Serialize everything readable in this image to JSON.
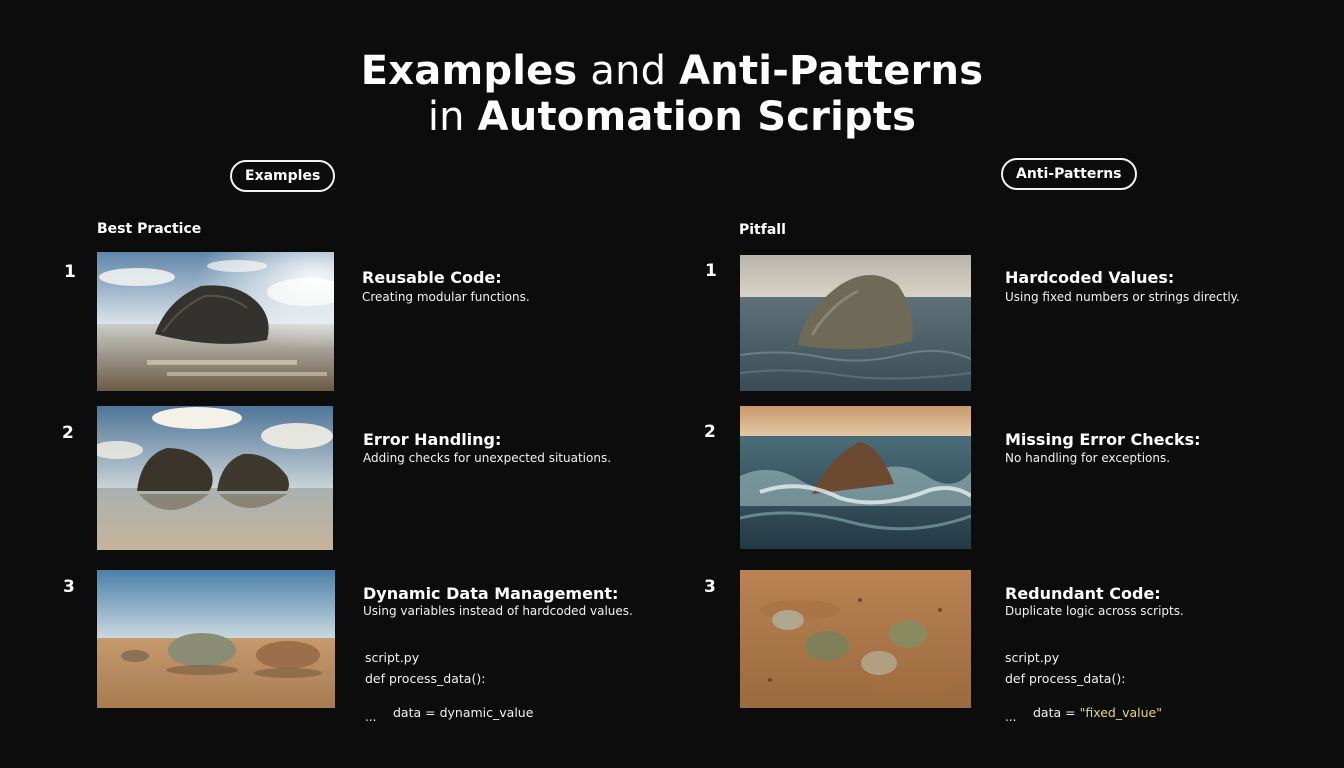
{
  "title": {
    "line1_bold_a": "Examples",
    "line1_mid": " and ",
    "line1_bold_b": "Anti-Patterns",
    "line2_pre": "in ",
    "line2_bold": "Automation Scripts"
  },
  "left": {
    "pill": "Examples",
    "label": "Best Practice",
    "items": [
      {
        "num": "1",
        "title": "Reusable Code:",
        "desc": "Creating modular functions.",
        "image": "boulder-on-sunlit-sea"
      },
      {
        "num": "2",
        "title": "Error Handling:",
        "desc": "Adding checks for unexpected situations.",
        "image": "two-boulders-calm-sea"
      },
      {
        "num": "3",
        "title": "Dynamic Data Management:",
        "desc": "Using variables instead of hardcoded values.",
        "image": "stones-on-sand-beach"
      }
    ],
    "code": {
      "file": "script.py",
      "def": "def process_data():",
      "dots": "...",
      "body": "data = dynamic_value"
    }
  },
  "right": {
    "pill": "Anti-Patterns",
    "label": "Pitfall",
    "items": [
      {
        "num": "1",
        "title": "Hardcoded Values:",
        "desc": "Using fixed numbers or strings directly.",
        "image": "rock-in-open-sea"
      },
      {
        "num": "2",
        "title": "Missing Error Checks:",
        "desc": "No handling for exceptions.",
        "image": "rock-in-breaking-waves"
      },
      {
        "num": "3",
        "title": "Redundant Code:",
        "desc": "Duplicate logic across scripts.",
        "image": "stones-in-sandy-dirt"
      }
    ],
    "code": {
      "file": "script.py",
      "def": "def process_data():",
      "dots": "...",
      "body_pre": "data = ",
      "body_string": "\"fixed_value\""
    }
  },
  "colors": {
    "background": "#0b0c0b",
    "text": "#ffffff",
    "code_string": "#e8d37a"
  }
}
